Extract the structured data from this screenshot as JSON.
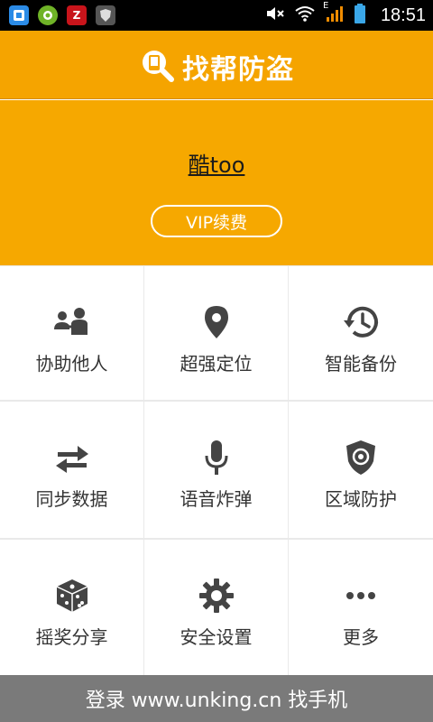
{
  "status_bar": {
    "time": "18:51",
    "signal_label": "E",
    "icons": [
      "settings-app-icon",
      "android-app-icon",
      "z-app-icon",
      "shield-app-icon",
      "mute-icon",
      "wifi-icon",
      "signal-icon",
      "battery-icon"
    ]
  },
  "header": {
    "title": "找帮防盗",
    "logo_icon": "search-phone-icon"
  },
  "profile": {
    "username": "酷too",
    "vip_button": "VIP续费"
  },
  "grid": [
    {
      "label": "协助他人",
      "icon": "people-icon"
    },
    {
      "label": "超强定位",
      "icon": "location-pin-icon"
    },
    {
      "label": "智能备份",
      "icon": "history-backup-icon"
    },
    {
      "label": "同步数据",
      "icon": "sync-arrows-icon"
    },
    {
      "label": "语音炸弹",
      "icon": "microphone-icon"
    },
    {
      "label": "区域防护",
      "icon": "shield-icon"
    },
    {
      "label": "摇奖分享",
      "icon": "dice-icon"
    },
    {
      "label": "安全设置",
      "icon": "gear-icon"
    },
    {
      "label": "更多",
      "icon": "more-dots-icon"
    }
  ],
  "footer": {
    "text": "登录 www.unking.cn 找手机"
  },
  "colors": {
    "accent": "#f5a400",
    "footer_bg": "#7a7a7a",
    "icon": "#444444"
  }
}
